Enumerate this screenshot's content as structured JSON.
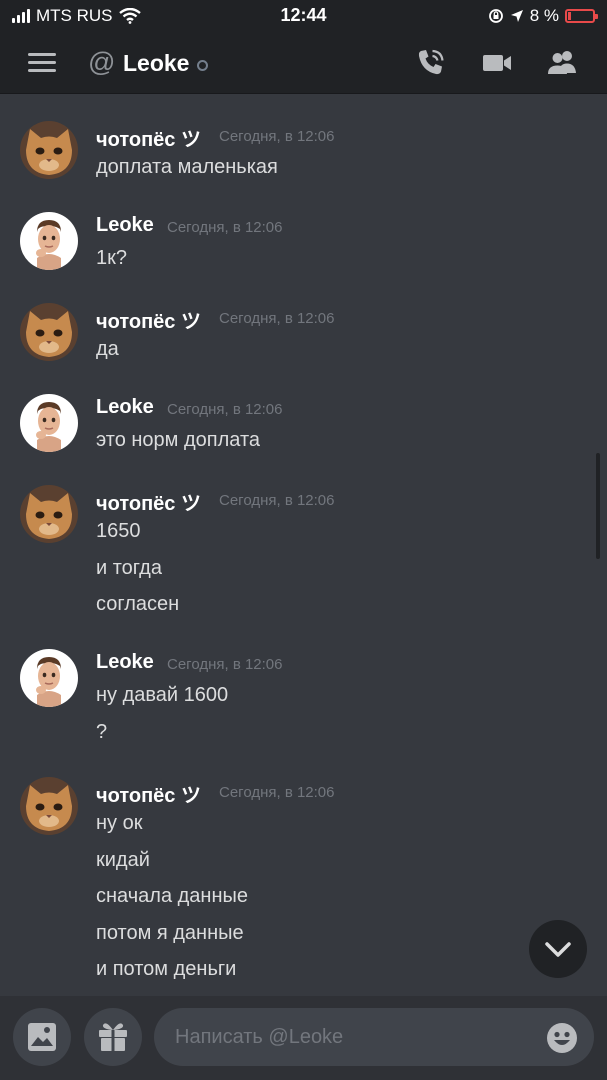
{
  "status_bar": {
    "carrier": "MTS RUS",
    "time": "12:44",
    "battery": "8 %"
  },
  "header": {
    "at": "@",
    "channel_name": "Leoke"
  },
  "messages": [
    {
      "author": "чотопёс ツ",
      "timestamp": "Сегодня, в 12:06",
      "lines": [
        "доплата маленькая"
      ]
    },
    {
      "author": "Leoke",
      "timestamp": "Сегодня, в 12:06",
      "lines": [
        "1к?"
      ]
    },
    {
      "author": "чотопёс ツ",
      "timestamp": "Сегодня, в 12:06",
      "lines": [
        "да"
      ]
    },
    {
      "author": "Leoke",
      "timestamp": "Сегодня, в 12:06",
      "lines": [
        "это норм доплата"
      ]
    },
    {
      "author": "чотопёс ツ",
      "timestamp": "Сегодня, в 12:06",
      "lines": [
        "1650",
        "и тогда",
        "согласен"
      ]
    },
    {
      "author": "Leoke",
      "timestamp": "Сегодня, в 12:06",
      "lines": [
        "ну давай 1600",
        "?"
      ]
    },
    {
      "author": "чотопёс ツ",
      "timestamp": "Сегодня, в 12:06",
      "lines": [
        "ну ок",
        "кидай",
        "сначала данные",
        "потом я данные",
        "и потом деньги"
      ]
    }
  ],
  "composer": {
    "placeholder": "Написать @Leoke"
  },
  "icons": {
    "menu": "hamburger-icon",
    "call": "phone-call-icon",
    "video": "video-camera-icon",
    "members": "members-icon",
    "jump": "chevron-down-icon",
    "image": "image-icon",
    "gift": "gift-icon",
    "emoji": "emoji-icon"
  },
  "colors": {
    "background": "#36393f",
    "header": "#202225",
    "composer": "#2f3136",
    "input": "#40444b",
    "battery_low": "#e84a4a"
  }
}
